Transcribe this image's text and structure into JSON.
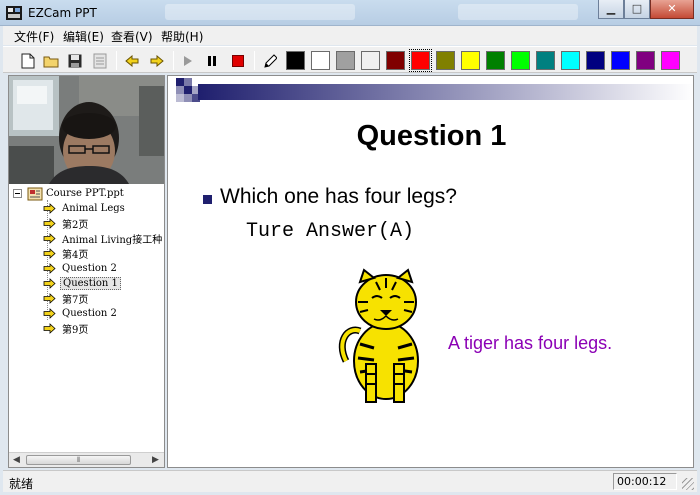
{
  "window": {
    "title": "EZCam PPT"
  },
  "menu": {
    "items": [
      "文件(F)",
      "编辑(E)",
      "查看(V)",
      "帮助(H)"
    ]
  },
  "toolbar": {
    "icons": [
      "new-file-icon",
      "open-folder-icon",
      "save-icon",
      "properties-icon",
      "previous-arrow-icon",
      "next-arrow-icon",
      "play-icon",
      "pause-icon",
      "stop-icon",
      "pen-icon"
    ],
    "colors": [
      "#000000",
      "#ffffff",
      "#a0a0a0",
      "#f0f0f0",
      "#800000",
      "#ff0000",
      "#808000",
      "#ffff00",
      "#008000",
      "#00ff00",
      "#008080",
      "#00ffff",
      "#000080",
      "#0000ff",
      "#800080",
      "#ff00ff"
    ],
    "selected_color": "#ff0000"
  },
  "tree": {
    "root": "Course PPT.ppt",
    "items": [
      "Animal Legs",
      "第2页",
      "Animal Living接工种",
      "第4页",
      "Question 2",
      "Question 1",
      "第7页",
      "Question 2",
      "第9页"
    ],
    "selected_index": 5
  },
  "slide": {
    "title": "Question 1",
    "bullet": "Which one has four legs?",
    "answer": "Ture Answer(A)",
    "caption": "A tiger has four legs.",
    "caption_color": "#8b00b5",
    "bullet_color": "#1f1f6e",
    "header_band_color": "#1f1f6e"
  },
  "status": {
    "text": "就绪",
    "time": "00:00:12"
  }
}
